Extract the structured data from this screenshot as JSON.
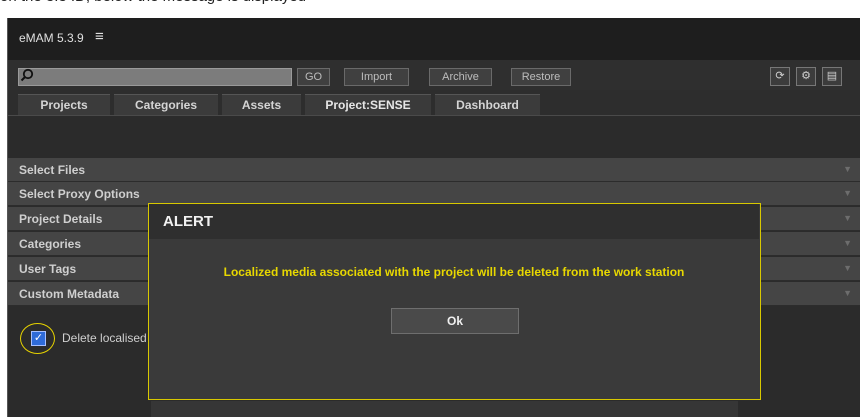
{
  "caption": "on the 3.3 ID, below the message is displayed",
  "app": {
    "title": "eMAM 5.3.9",
    "menu_icon": "hamburger-menu-icon"
  },
  "toolbar": {
    "search_placeholder": "",
    "buttons": [
      "GO",
      "Import",
      "Archive",
      "Restore"
    ],
    "icon_buttons": [
      "refresh-icon",
      "gear-icon",
      "document-icon"
    ]
  },
  "tabs": [
    "Projects",
    "Categories",
    "Assets",
    "Project:SENSE",
    "Dashboard"
  ],
  "active_tab": "Project:SENSE",
  "sections": [
    "Select Files",
    "Select Proxy Options",
    "Project Details",
    "Categories",
    "User Tags",
    "Custom Metadata"
  ],
  "checkbox": {
    "label": "Delete localised media",
    "checked": true
  },
  "dialog": {
    "title": "ALERT",
    "message": "Localized media associated with the project will be deleted from the work station",
    "ok_label": "Ok"
  },
  "colors": {
    "highlight": "#d8c800",
    "checkbox": "#2f6bd8"
  }
}
